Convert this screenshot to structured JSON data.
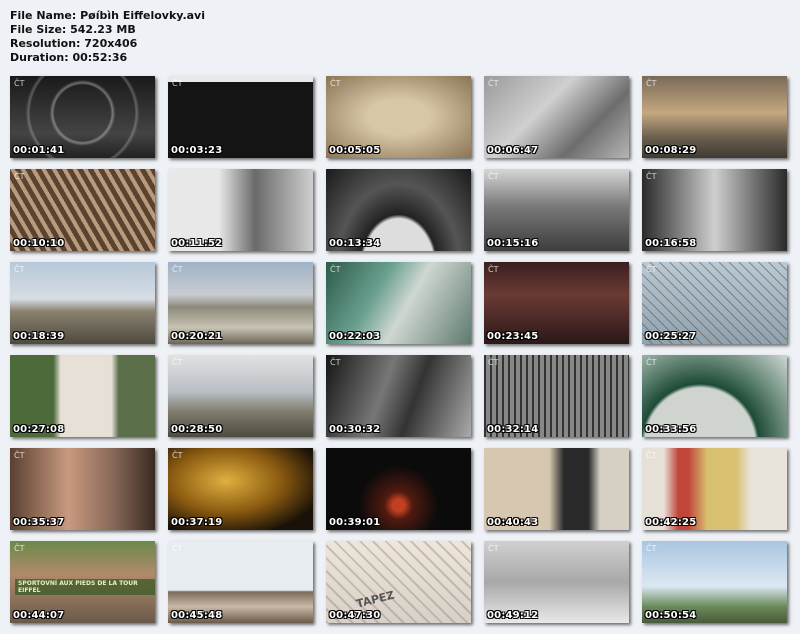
{
  "file_info": {
    "name_line": "File Name: Pøíbìh Eiffelovky.avi",
    "size_line": "File Size: 542.23 MB",
    "resolution_line": "Resolution: 720x406",
    "duration_line": "Duration: 00:52:36"
  },
  "thumbnails": [
    {
      "time": "00:01:41",
      "scene": "bw-tower-rings",
      "logo": "ČT"
    },
    {
      "time": "00:03:23",
      "scene": "dark-film-frame",
      "logo": "ČT"
    },
    {
      "time": "00:05:05",
      "scene": "sepia-tower-drawing",
      "logo": "ČT"
    },
    {
      "time": "00:06:47",
      "scene": "bw-construction-base",
      "logo": "ČT"
    },
    {
      "time": "00:08:29",
      "scene": "sunset-paris",
      "logo": "ČT"
    },
    {
      "time": "00:10:10",
      "scene": "iron-staircases",
      "logo": "ČT"
    },
    {
      "time": "00:11:52",
      "scene": "bw-portrait-eiffel",
      "logo": ""
    },
    {
      "time": "00:13:34",
      "scene": "bw-arch-underside",
      "logo": ""
    },
    {
      "time": "00:15:16",
      "scene": "bw-aerial-tower",
      "logo": "ČT"
    },
    {
      "time": "00:16:58",
      "scene": "bw-cameras-woman",
      "logo": "ČT"
    },
    {
      "time": "00:18:39",
      "scene": "paris-skyline-tower",
      "logo": "ČT"
    },
    {
      "time": "00:20:21",
      "scene": "trocadero-la-defense",
      "logo": "ČT"
    },
    {
      "time": "00:22:03",
      "scene": "climber-on-girder",
      "logo": "ČT"
    },
    {
      "time": "00:23:45",
      "scene": "crowd-portrait",
      "logo": "ČT"
    },
    {
      "time": "00:25:27",
      "scene": "presenter-platform",
      "logo": "ČT"
    },
    {
      "time": "00:27:08",
      "scene": "poster-street",
      "logo": ""
    },
    {
      "time": "00:28:50",
      "scene": "cloudy-panorama",
      "logo": "ČT"
    },
    {
      "time": "00:30:32",
      "scene": "bw-workers-climbing",
      "logo": "ČT"
    },
    {
      "time": "00:32:14",
      "scene": "dark-lattice",
      "logo": "ČT"
    },
    {
      "time": "00:33:56",
      "scene": "green-arch",
      "logo": "ČT"
    },
    {
      "time": "00:35:37",
      "scene": "tourists-photographing",
      "logo": "ČT"
    },
    {
      "time": "00:37:19",
      "scene": "golden-tower-night",
      "logo": "ČT"
    },
    {
      "time": "00:39:01",
      "scene": "night-tower-lights",
      "logo": ""
    },
    {
      "time": "00:40:43",
      "scene": "street-signal-poster",
      "logo": ""
    },
    {
      "time": "00:42:25",
      "scene": "no-entry-poster",
      "logo": "ČT"
    },
    {
      "time": "00:44:07",
      "scene": "woman-red-cap",
      "logo": "ČT",
      "overlay": "SPORTOVNÍ AUX PIEDS DE LA TOUR EIFFEL"
    },
    {
      "time": "00:45:48",
      "scene": "tower-top-rooftops",
      "logo": "ČT"
    },
    {
      "time": "00:47:30",
      "scene": "tapez-3",
      "logo": "",
      "overlay": "TAPEZ"
    },
    {
      "time": "00:49:12",
      "scene": "walking-feet",
      "logo": "ČT"
    },
    {
      "time": "00:50:54",
      "scene": "presenter-fountains",
      "logo": "ČT"
    }
  ]
}
